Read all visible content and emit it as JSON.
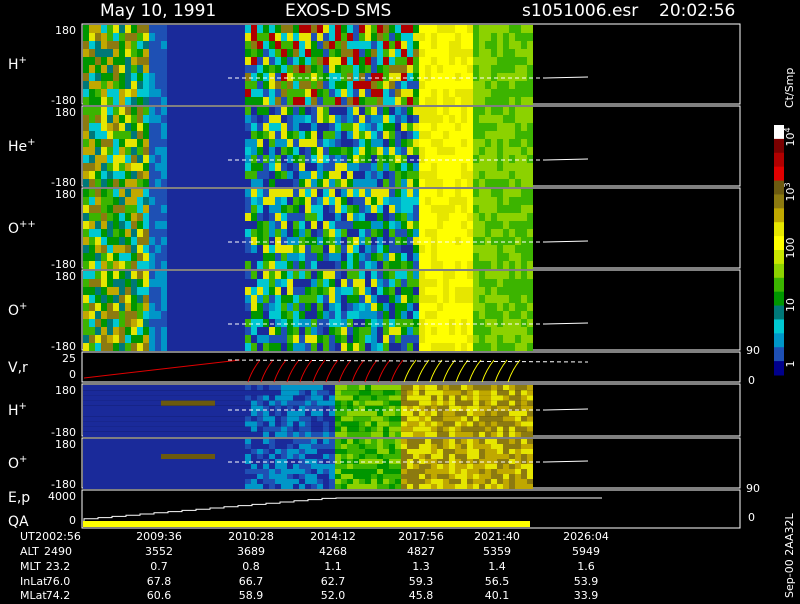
{
  "header": {
    "date": "May 10, 1991",
    "instrument": "EXOS-D SMS",
    "file": "s1051006.esr",
    "time": "20:02:56"
  },
  "colorbar": {
    "unit": "Ct/Smp",
    "ticks": [
      "10^4",
      "10^3",
      "100",
      "10",
      "1"
    ],
    "colors": [
      "#ffffff",
      "#7a0000",
      "#b00000",
      "#e00000",
      "#6b5a10",
      "#8c7a10",
      "#c0a800",
      "#e6e600",
      "#ffff00",
      "#c8e600",
      "#8cd200",
      "#3cb400",
      "#009600",
      "#007878",
      "#00c8d2",
      "#0096c8",
      "#1e50b4",
      "#00008c"
    ]
  },
  "rotated_footer": "Sep-00  2AA32L",
  "chart_data": {
    "type": "heatmap",
    "x_axis_type": "time",
    "panels": [
      {
        "label": "H",
        "superscript": "+",
        "ylim_labels": [
          "180",
          "-180"
        ]
      },
      {
        "label": "He",
        "superscript": "+",
        "ylim_labels": [
          "180",
          "-180"
        ]
      },
      {
        "label": "O",
        "superscript": "++",
        "ylim_labels": [
          "180",
          "-180"
        ]
      },
      {
        "label": "O",
        "superscript": "+",
        "ylim_labels": [
          "180",
          "-180"
        ]
      },
      {
        "label": "V,r",
        "superscript": "",
        "ylim_labels": [
          "25",
          "0"
        ],
        "right_labels": [
          "90",
          "0"
        ]
      },
      {
        "label": "H",
        "superscript": "+",
        "ylim_labels": [
          "180",
          "-180"
        ]
      },
      {
        "label": "O",
        "superscript": "+",
        "ylim_labels": [
          "180",
          "-180"
        ]
      },
      {
        "label": "E,p",
        "label2": "QA",
        "superscript": "",
        "ylim_labels": [
          "4000",
          "0"
        ],
        "right_labels": [
          "90",
          "0"
        ]
      }
    ],
    "ephemeris": {
      "row_labels": [
        "UT",
        "ALT",
        "MLT",
        "InLat",
        "MLat"
      ],
      "columns": [
        [
          "2002:56",
          "2490",
          "23.2",
          "76.0",
          "74.2"
        ],
        [
          "2009:36",
          "3552",
          "0.7",
          "67.8",
          "60.6"
        ],
        [
          "2010:28",
          "3689",
          "0.8",
          "66.7",
          "58.9"
        ],
        [
          "2014:12",
          "4268",
          "1.1",
          "62.7",
          "52.0"
        ],
        [
          "2017:56",
          "4827",
          "1.3",
          "59.3",
          "45.8"
        ],
        [
          "2021:40",
          "5359",
          "1.4",
          "56.5",
          "40.1"
        ],
        [
          "2026:04",
          "5949",
          "1.6",
          "53.9",
          "33.9"
        ]
      ]
    }
  }
}
